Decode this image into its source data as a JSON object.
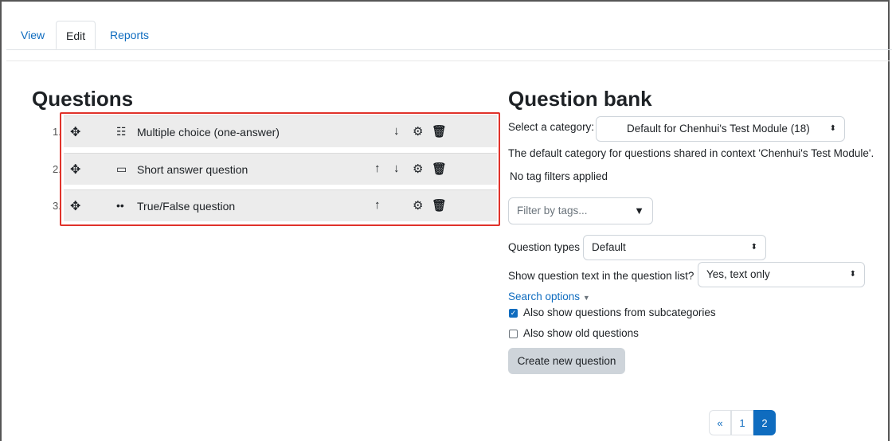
{
  "tabs": [
    {
      "label": "View",
      "active": false
    },
    {
      "label": "Edit",
      "active": true
    },
    {
      "label": "Reports",
      "active": false
    }
  ],
  "questions": {
    "title": "Questions",
    "items": [
      {
        "number": "1.",
        "type_icon": "list-icon",
        "name": "Multiple choice (one-answer)"
      },
      {
        "number": "2.",
        "type_icon": "short-answer-icon",
        "name": "Short answer question"
      },
      {
        "number": "3.",
        "type_icon": "true-false-icon",
        "name": "True/False question"
      }
    ]
  },
  "bank": {
    "title": "Question bank",
    "category_label": "Select a category:",
    "category_value": "Default for Chenhui's Test Module (18)",
    "category_help": "The default category for questions shared in context 'Chenhui's Test Module'.",
    "tag_status": "No tag filters applied",
    "tag_placeholder": "Filter by tags...",
    "qtypes_label": "Question types",
    "qtypes_value": "Default",
    "showtext_label": "Show question text in the question list?",
    "showtext_value": "Yes, text only",
    "search_options": "Search options",
    "subcats_label": "Also show questions from subcategories",
    "subcats_checked": true,
    "old_label": "Also show old questions",
    "old_checked": false,
    "create_button": "Create new question"
  },
  "pagination": {
    "prev": "«",
    "pages": [
      "1",
      "2"
    ],
    "current": "2"
  },
  "colors": {
    "link": "#0f6cbf",
    "highlight_box": "#e0322a"
  }
}
